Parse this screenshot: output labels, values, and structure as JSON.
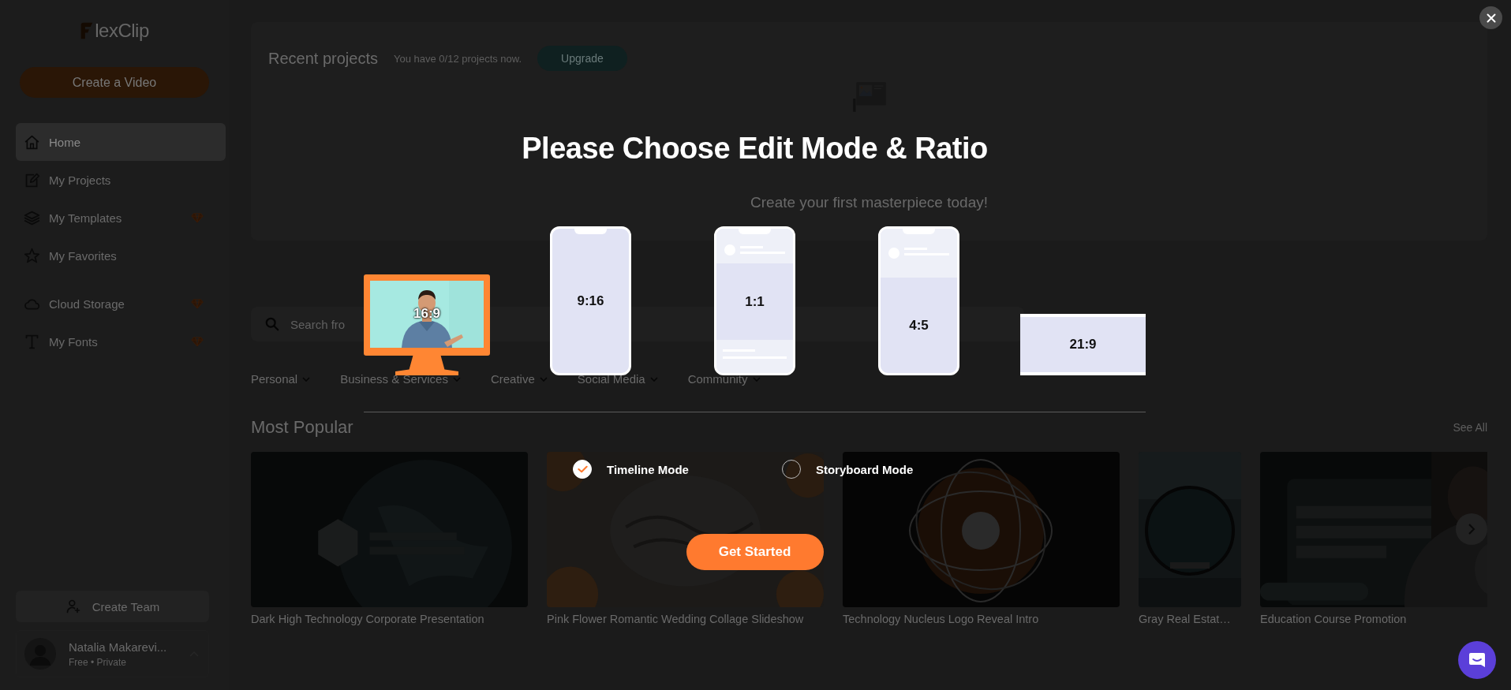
{
  "sidebar": {
    "logo": "lexClip",
    "create_button": "Create a Video",
    "sections": [
      {
        "items": [
          {
            "label": "Home",
            "selected": true,
            "premium": false
          },
          {
            "label": "My Projects",
            "selected": false,
            "premium": false
          },
          {
            "label": "My Templates",
            "selected": false,
            "premium": true
          },
          {
            "label": "My Favorites",
            "selected": false,
            "premium": false
          }
        ]
      },
      {
        "items": [
          {
            "label": "Cloud Storage",
            "selected": false,
            "premium": true
          },
          {
            "label": "My Fonts",
            "selected": false,
            "premium": true
          }
        ]
      }
    ],
    "team_button": "Create Team",
    "user": {
      "name": "Natalia Makarevi...",
      "plan": "Free • Private"
    }
  },
  "recent": {
    "title": "Recent projects",
    "quota": "You have 0/12 projects now.",
    "upgrade": "Upgrade",
    "empty_message": "Create your first masterpiece today!"
  },
  "search": {
    "placeholder": "Search fro"
  },
  "categories": [
    "Personal",
    "Business & Services",
    "Creative",
    "Social Media",
    "Community"
  ],
  "popular": {
    "title": "Most Popular",
    "see_all": "See All",
    "templates": [
      {
        "title": "Dark High Technology Corporate Presentation",
        "kind": "wide"
      },
      {
        "title": "Pink Flower Romantic Wedding Collage Slideshow",
        "kind": "wide"
      },
      {
        "title": "Technology Nucleus Logo Reveal Intro",
        "kind": "wide"
      },
      {
        "title": "Gray Real Estat…",
        "kind": "narrow"
      },
      {
        "title": "Education Course Promotion",
        "kind": "wide"
      }
    ]
  },
  "modal": {
    "title": "Please Choose Edit Mode & Ratio",
    "ratios": [
      {
        "label": "16:9",
        "kind": "monitor",
        "selected": true
      },
      {
        "label": "9:16",
        "kind": "phone",
        "selected": false
      },
      {
        "label": "1:1",
        "kind": "post",
        "selected": false
      },
      {
        "label": "4:5",
        "kind": "post-tall",
        "selected": false
      },
      {
        "label": "21:9",
        "kind": "wide",
        "selected": false
      }
    ],
    "modes": [
      {
        "label": "Timeline Mode",
        "selected": true
      },
      {
        "label": "Storyboard Mode",
        "selected": false
      }
    ],
    "start_button": "Get Started"
  }
}
